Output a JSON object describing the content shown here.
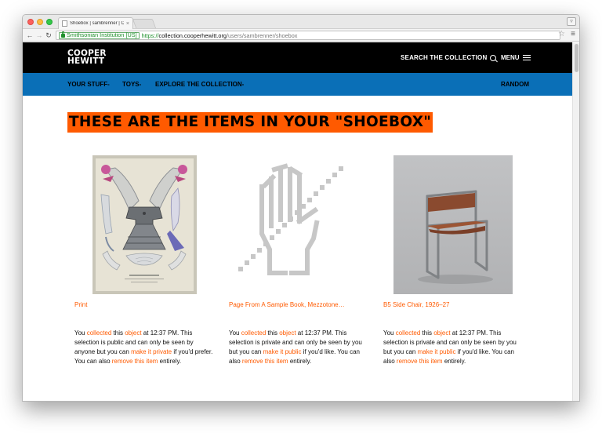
{
  "browser": {
    "tab_title": "Shoebox | sambrenner | Co",
    "tab_close": "×",
    "ev_label": "Smithsonian Institution [US]",
    "url_scheme": "https://",
    "url_host": "collection.cooperhewitt.org",
    "url_path": "/users/sambrenner/shoebox"
  },
  "header": {
    "logo_line1": "COOPER",
    "logo_line2": "HEWITT",
    "search_label": "SEARCH THE COLLECTION",
    "menu_label": "MENU"
  },
  "subnav": {
    "your_stuff": "YOUR STUFF-",
    "toys": "TOYS-",
    "explore": "EXPLORE THE COLLECTION-",
    "random": "RANDOM"
  },
  "page": {
    "heading": "THESE ARE THE ITEMS IN YOUR \"SHOEBOX\""
  },
  "items": [
    {
      "title": "Print",
      "image": "fashion-plate-print",
      "p1": "You ",
      "collected_link": "collected",
      "p2": " this ",
      "object_link": "object",
      "p3": " at 12:37 PM. This selection is public and can only be seen by anyone but you can ",
      "privacy_link": "make it private",
      "p4": " if you'd prefer. You can also ",
      "remove_link": "remove this item",
      "p5": " entirely."
    },
    {
      "title": "Page From A Sample Book, Mezzotone…",
      "image": "no-image-hand-icon",
      "p1": "You ",
      "collected_link": "collected",
      "p2": " this ",
      "object_link": "object",
      "p3": " at 12:37 PM. This selection is private and can only be seen by you but you can ",
      "privacy_link": "make it public",
      "p4": " if you'd like. You can also ",
      "remove_link": "remove this item",
      "p5": " entirely."
    },
    {
      "title": "B5 Side Chair, 1926–27",
      "image": "side-chair-photo",
      "p1": "You ",
      "collected_link": "collected",
      "p2": " this ",
      "object_link": "object",
      "p3": " at 12:37 PM. This selection is private and can only be seen by you but you can ",
      "privacy_link": "make it public",
      "p4": " if you'd like. You can also ",
      "remove_link": "remove this item",
      "p5": " entirely."
    }
  ],
  "colors": {
    "accent": "#ff5a00",
    "nav_blue": "#0a6fb7",
    "header_black": "#000000"
  }
}
